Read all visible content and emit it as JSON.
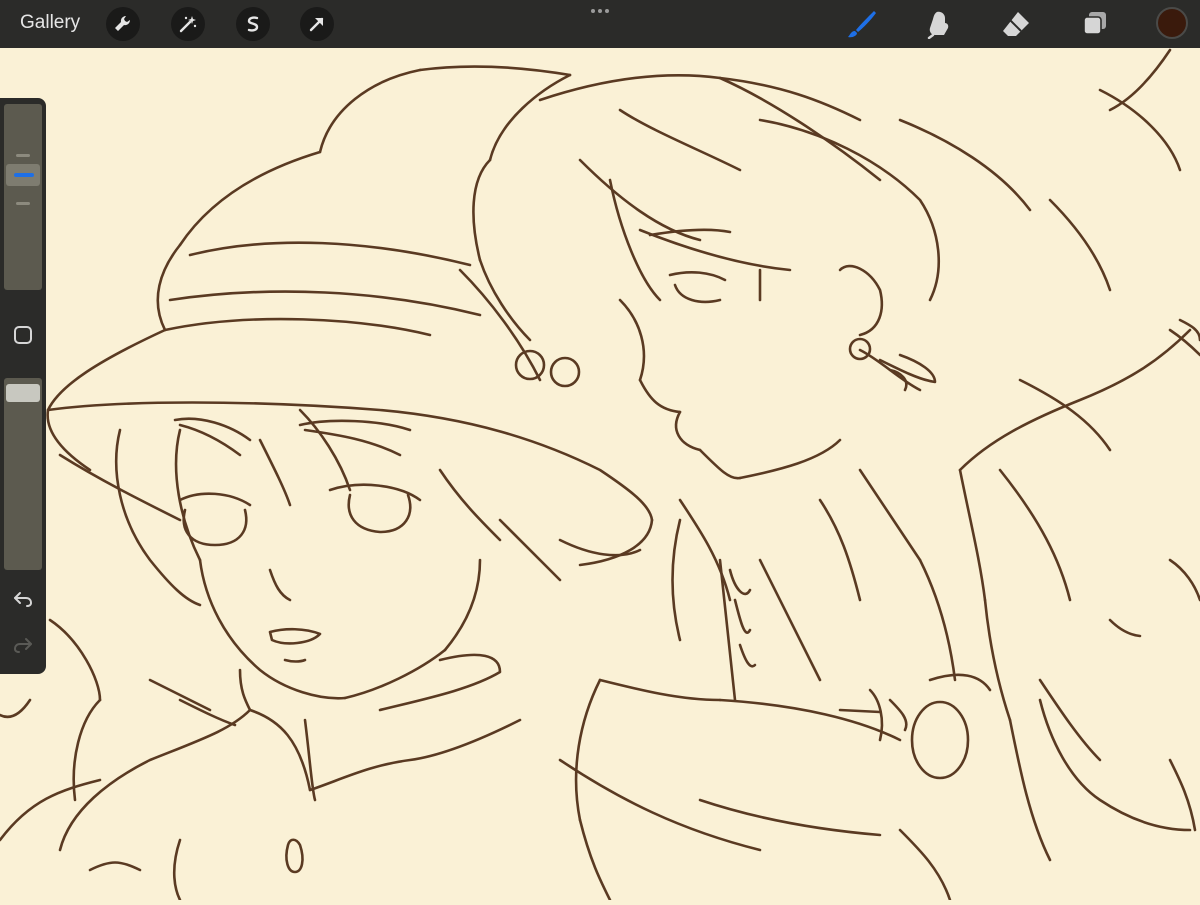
{
  "topbar": {
    "gallery_label": "Gallery",
    "left_tools": [
      {
        "name": "actions",
        "icon": "wrench-icon"
      },
      {
        "name": "adjustments",
        "icon": "magic-wand-icon"
      },
      {
        "name": "selection",
        "icon": "selection-s-icon"
      },
      {
        "name": "transform",
        "icon": "arrow-cursor-icon"
      }
    ],
    "right_tools": [
      {
        "name": "brush",
        "icon": "brush-icon",
        "active": true
      },
      {
        "name": "smudge",
        "icon": "smudge-icon",
        "active": false
      },
      {
        "name": "eraser",
        "icon": "eraser-icon",
        "active": false
      },
      {
        "name": "layers",
        "icon": "layers-icon",
        "active": false
      }
    ],
    "current_color": "#3A1A0C"
  },
  "sidebar": {
    "brush_size_slider": {
      "icon": "size-slider"
    },
    "modify_button": {
      "icon": "square-modify-icon"
    },
    "opacity_slider": {
      "icon": "opacity-slider"
    },
    "undo": {
      "icon": "undo-icon"
    },
    "redo": {
      "icon": "redo-icon",
      "enabled": false
    }
  },
  "colors": {
    "accent": "#1E6FE6",
    "paper": "#FAF1D6",
    "ink": "#5A3A22",
    "toolbar": "#2B2B29"
  }
}
